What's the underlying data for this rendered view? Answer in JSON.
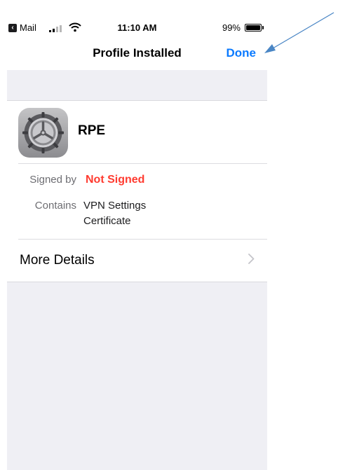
{
  "status_bar": {
    "back_app": "Mail",
    "time": "11:10 AM",
    "battery": "99%"
  },
  "nav": {
    "title": "Profile Installed",
    "done_label": "Done"
  },
  "profile": {
    "name": "RPE",
    "icon": "settings-gear-icon"
  },
  "details": {
    "signed_by_label": "Signed by",
    "signed_by_value": "Not Signed",
    "contains_label": "Contains",
    "contains": [
      "VPN Settings",
      "Certificate"
    ]
  },
  "more_details": {
    "label": "More Details"
  },
  "colors": {
    "accent": "#0a7aff",
    "warning": "#ff3b30",
    "group_background": "#efeff4",
    "annotation_arrow": "#4a86c5"
  }
}
